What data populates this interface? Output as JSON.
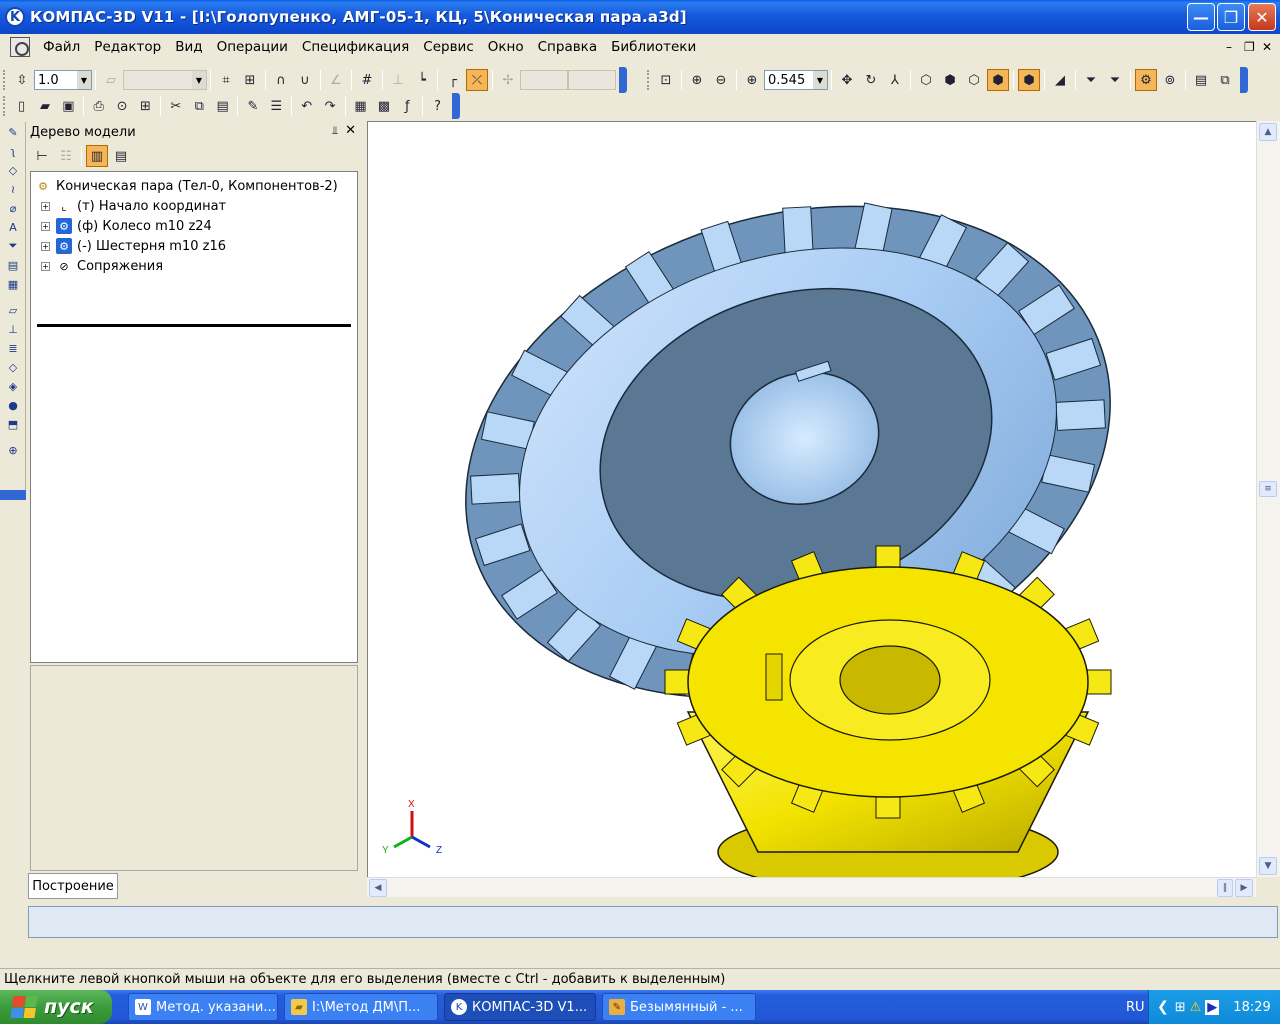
{
  "window": {
    "title": "КОМПАС-3D V11 - [I:\\Голопупенко, АМГ-05-1, КЦ, 5\\Коническая пара.a3d]",
    "app_icon": "K",
    "minimize": "—",
    "maximize": "❐",
    "close": "✕"
  },
  "menu": [
    "Файл",
    "Редактор",
    "Вид",
    "Операции",
    "Спецификация",
    "Сервис",
    "Окно",
    "Справка",
    "Библиотеки"
  ],
  "mdi_controls": {
    "minimize": "–",
    "restore": "❐",
    "close": "✕"
  },
  "toolbar": {
    "step_value": "1.0",
    "zoom_value": "0.545"
  },
  "tree": {
    "title": "Дерево модели",
    "pin": "⫫",
    "close": "✕",
    "root": "Коническая пара (Тел-0, Компонентов-2)",
    "nodes": [
      "(т) Начало координат",
      "(ф) Колесо m10 z24",
      "(-) Шестерня m10 z16",
      "Сопряжения"
    ],
    "tab": "Построение"
  },
  "axes": {
    "x": "X",
    "y": "Y",
    "z": "Z"
  },
  "status": "Щелкните левой кнопкой мыши на объекте для его выделения (вместе с Ctrl - добавить к выделенным)",
  "taskbar": {
    "start": "пуск",
    "tasks": [
      "Метод. указани...",
      "I:\\Метод ДМ\\П...",
      "КОМПАС-3D V1...",
      "Безымянный - ..."
    ],
    "lang": "RU",
    "time": "18:29"
  },
  "colors": {
    "wheel": "#a9cdf4",
    "pinion": "#f2e200",
    "hub": "#5a7794",
    "titlebar": "#0a5fe8"
  }
}
